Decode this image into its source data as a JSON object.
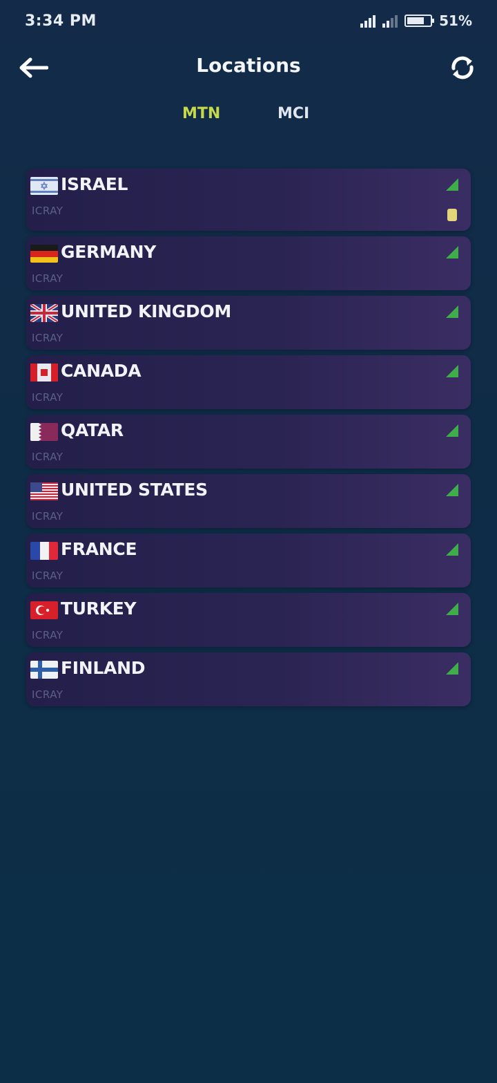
{
  "status_bar": {
    "time": "3:34 PM",
    "battery": "51%"
  },
  "header": {
    "title": "Locations",
    "back_icon": "arrow-left-icon",
    "refresh_icon": "refresh-icon"
  },
  "tabs": [
    {
      "label": "MTN",
      "active": true,
      "color": "#c6d94a"
    },
    {
      "label": "MCI",
      "active": false,
      "color": "#dfe6ee"
    }
  ],
  "servers": [
    {
      "country": "ISRAEL",
      "sub": "ICRAY",
      "flag": "israel"
    },
    {
      "country": "GERMANY",
      "sub": "ICRAY",
      "flag": "germany"
    },
    {
      "country": "UNITED KINGDOM",
      "sub": "ICRAY",
      "flag": "uk"
    },
    {
      "country": "CANADA",
      "sub": "ICRAY",
      "flag": "canada"
    },
    {
      "country": "QATAR",
      "sub": "ICRAY",
      "flag": "qatar"
    },
    {
      "country": "UNITED STATES",
      "sub": "ICRAY",
      "flag": "usa"
    },
    {
      "country": "FRANCE",
      "sub": "ICRAY",
      "flag": "france"
    },
    {
      "country": "TURKEY",
      "sub": "ICRAY",
      "flag": "turkey"
    },
    {
      "country": "FINLAND",
      "sub": "ICRAY",
      "flag": "finland"
    }
  ],
  "colors": {
    "background": "#0f2c47",
    "card": "#2a2452",
    "signal": "#3fae4a",
    "active_tab": "#c6d94a"
  }
}
